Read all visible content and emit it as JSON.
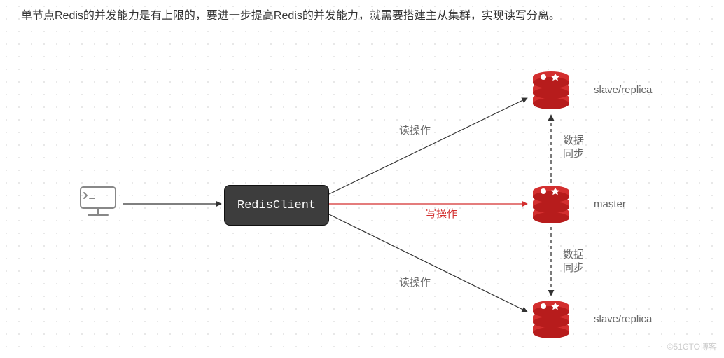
{
  "heading": "单节点Redis的并发能力是有上限的，要进一步提高Redis的并发能力，就需要搭建主从集群，实现读写分离。",
  "client_label": "RedisClient",
  "nodes": {
    "slave_top": "slave/replica",
    "master": "master",
    "slave_bottom": "slave/replica"
  },
  "edge_labels": {
    "read_top": "读操作",
    "write": "写操作",
    "read_bottom": "读操作",
    "sync_top": "数据\n同步",
    "sync_bottom": "数据\n同步"
  },
  "watermark": "©51CTO博客"
}
